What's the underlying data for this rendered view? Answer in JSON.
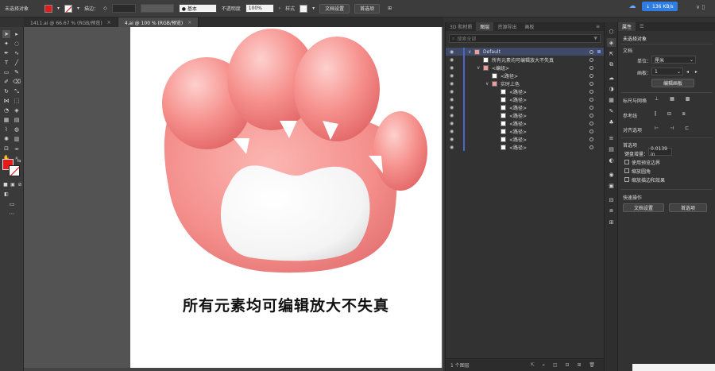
{
  "control_bar": {
    "selection_label": "未选择对象",
    "fill_color": "#e8191b",
    "stroke_label": "描边：",
    "stroke_spin": "◇",
    "brush_label": "● 基本",
    "opacity_label": "不透明度",
    "opacity_value": "100%",
    "style_label": "样式",
    "doc_setup_button": "文档设置",
    "prefs_button": "首选项"
  },
  "tabs": [
    {
      "label": "1411.ai @ 66.67 % (RGB/预览)",
      "active": false
    },
    {
      "label": "4.ai @ 100 % (RGB/预览)",
      "active": true
    }
  ],
  "canvas": {
    "caption": "所有元素均可编辑放大不失真",
    "artboard_color": "#ffffff",
    "workspace_color": "#535353"
  },
  "layers_panel": {
    "tabs": [
      "3D 和材质",
      "图层",
      "资源导出",
      "画板"
    ],
    "active_tab": "图层",
    "search_placeholder": "搜索全部",
    "rows": [
      {
        "indent": 0,
        "label": "Default",
        "expander": "∨",
        "thumb": "layer"
      },
      {
        "indent": 1,
        "label": "所有元素均可编辑放大不失真",
        "expander": "",
        "thumb": "text"
      },
      {
        "indent": 1,
        "label": "<编组>",
        "expander": "∨",
        "thumb": "group"
      },
      {
        "indent": 2,
        "label": "<路径>",
        "expander": "",
        "thumb": "white"
      },
      {
        "indent": 2,
        "label": "实时上色",
        "expander": "∨",
        "thumb": "group"
      },
      {
        "indent": 3,
        "label": "<路径>",
        "expander": "",
        "thumb": "white"
      },
      {
        "indent": 3,
        "label": "<路径>",
        "expander": "",
        "thumb": "white"
      },
      {
        "indent": 3,
        "label": "<路径>",
        "expander": "",
        "thumb": "white"
      },
      {
        "indent": 3,
        "label": "<路径>",
        "expander": "",
        "thumb": "white"
      },
      {
        "indent": 3,
        "label": "<路径>",
        "expander": "",
        "thumb": "white"
      },
      {
        "indent": 3,
        "label": "<路径>",
        "expander": "",
        "thumb": "white"
      },
      {
        "indent": 3,
        "label": "<路径>",
        "expander": "",
        "thumb": "white"
      },
      {
        "indent": 3,
        "label": "<路径>",
        "expander": "",
        "thumb": "white"
      }
    ],
    "footer": "1 个图层"
  },
  "properties_panel": {
    "tab_props": "属性",
    "tab_menu": "☰",
    "no_selection": "未选择对象",
    "doc_section": "文档",
    "unit_label": "单位：",
    "unit_value": "厘米",
    "artboard_label": "画板：",
    "artboard_value": "1",
    "edit_artboard_button": "编辑画板",
    "ruler_grid": "标尺与网格",
    "guides": "参考线",
    "align_options": "对齐选项",
    "prefs_section": "首选项",
    "keyboard_increment_label": "键盘增量：",
    "keyboard_increment_value": "0.0139 in",
    "check_preview_bounds": "使用预览边界",
    "check_scale_corners": "缩放圆角",
    "check_scale_strokes": "缩放描边和效果",
    "quick_actions": "快速操作",
    "doc_setup_button": "文档设置",
    "prefs_button": "首选项"
  },
  "network_badge": "136 KB/s"
}
